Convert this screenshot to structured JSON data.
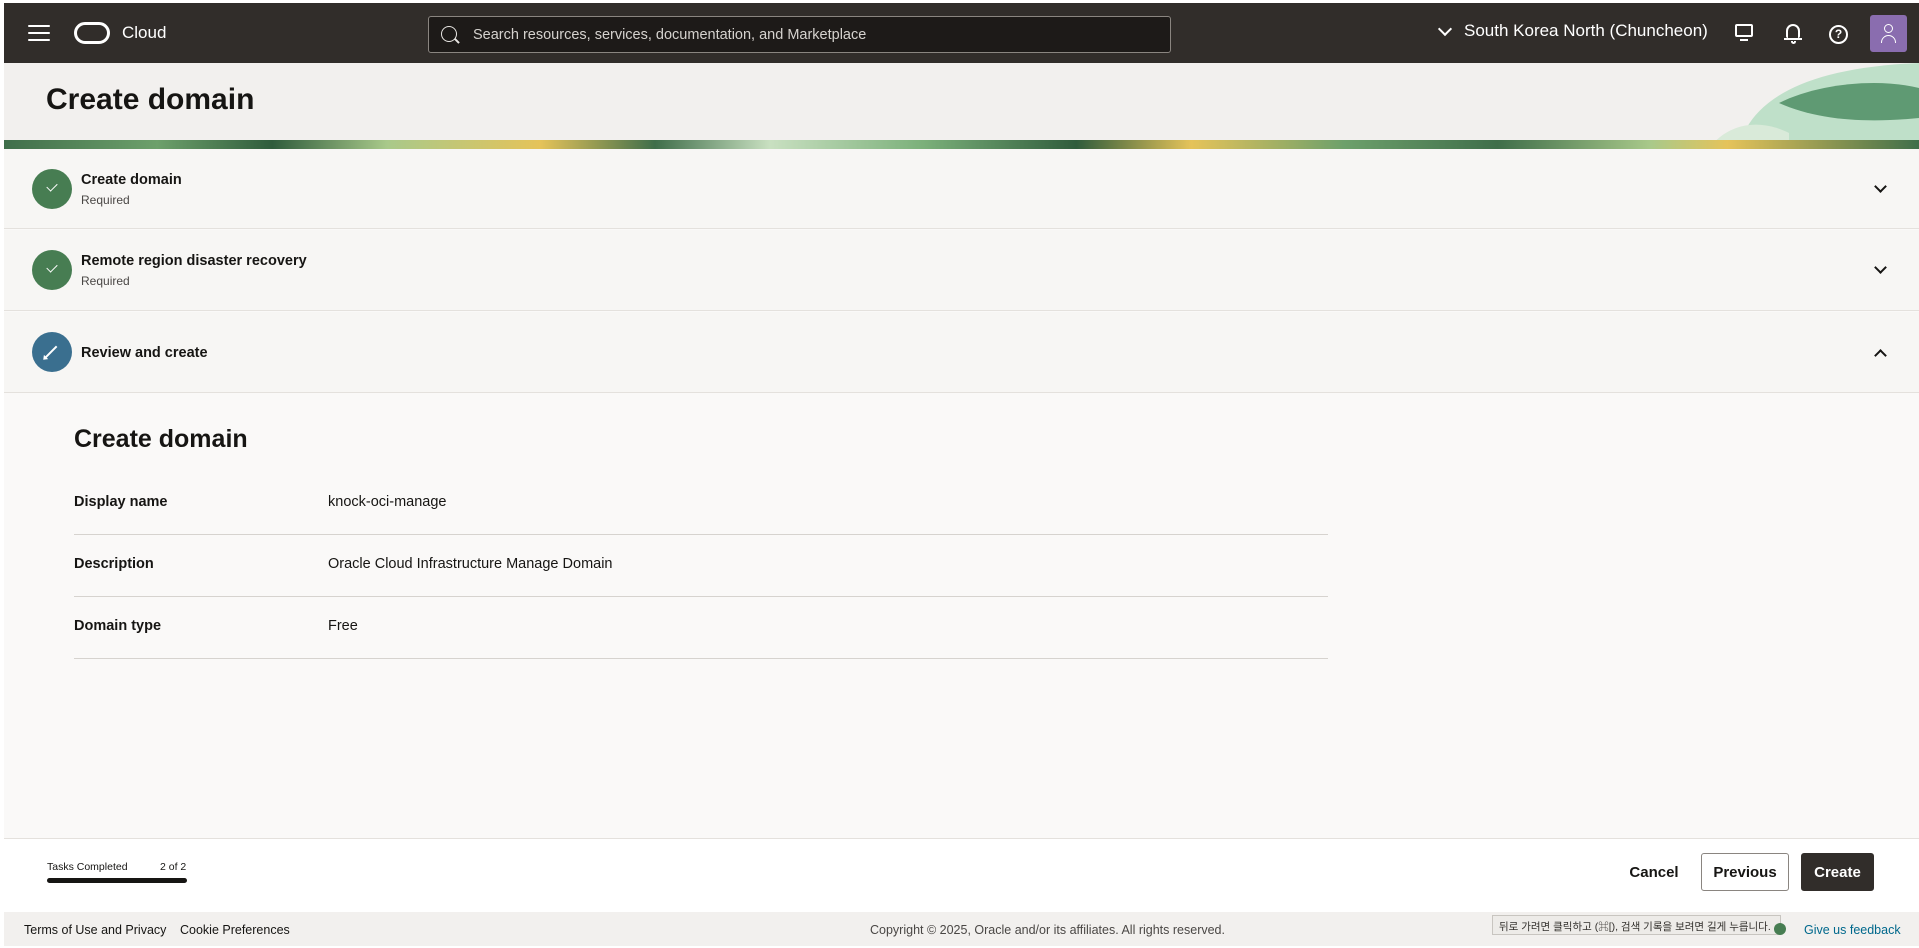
{
  "header": {
    "brand": "Cloud",
    "search_placeholder": "Search resources, services, documentation, and Marketplace",
    "region": "South Korea North (Chuncheon)"
  },
  "page": {
    "title": "Create domain"
  },
  "steps": [
    {
      "title": "Create domain",
      "subtitle": "Required",
      "status": "complete"
    },
    {
      "title": "Remote region disaster recovery",
      "subtitle": "Required",
      "status": "complete"
    },
    {
      "title": "Review and create",
      "subtitle": "",
      "status": "current"
    }
  ],
  "review": {
    "title": "Create domain",
    "rows": [
      {
        "label": "Display name",
        "value": "knock-oci-manage"
      },
      {
        "label": "Description",
        "value": "Oracle Cloud Infrastructure Manage Domain"
      },
      {
        "label": "Domain type",
        "value": "Free"
      }
    ]
  },
  "actions": {
    "tasks_label": "Tasks Completed",
    "tasks_count": "2 of 2",
    "progress_fraction": 1.0,
    "cancel": "Cancel",
    "previous": "Previous",
    "create": "Create"
  },
  "footer": {
    "terms": "Terms of Use and Privacy",
    "cookie": "Cookie Preferences",
    "copyright": "Copyright © 2025, Oracle and/or its affiliates. All rights reserved.",
    "tooltip": "뒤로 가려면 클릭하고 (⌘[), 검색 기록을 보려면 길게 누릅니다.",
    "feedback": "Give us feedback"
  },
  "colors": {
    "header_bg": "#312d2a",
    "complete": "#477d52",
    "current": "#3a6f8f",
    "primary_button": "#312d2a",
    "link": "#00688c"
  },
  "icons": [
    "menu-icon",
    "oracle-logo-icon",
    "search-icon",
    "chevron-down-icon",
    "monitor-icon",
    "bell-icon",
    "help-icon",
    "user-icon",
    "check-icon",
    "pencil-icon",
    "chevron-up-icon"
  ]
}
